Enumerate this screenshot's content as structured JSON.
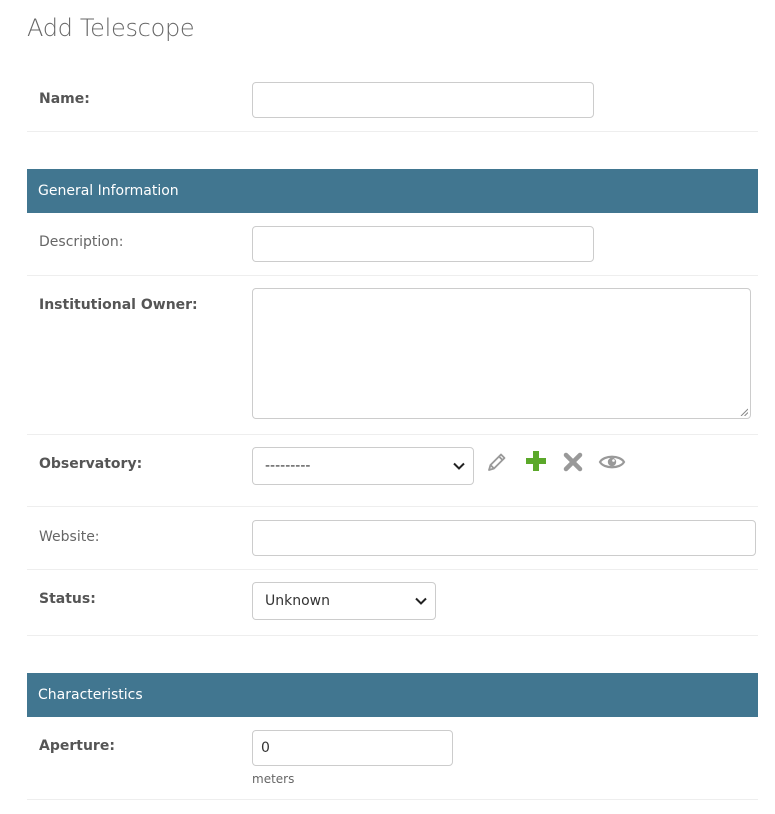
{
  "page": {
    "title": "Add Telescope"
  },
  "fields": {
    "name": {
      "label": "Name:",
      "value": ""
    },
    "description": {
      "label": "Description:",
      "value": ""
    },
    "institutional_owner": {
      "label": "Institutional Owner:",
      "value": ""
    },
    "observatory": {
      "label": "Observatory:",
      "selected": "---------"
    },
    "website": {
      "label": "Website:",
      "value": ""
    },
    "status": {
      "label": "Status:",
      "selected": "Unknown"
    },
    "aperture": {
      "label": "Aperture:",
      "value": "0",
      "help": "meters"
    }
  },
  "sections": {
    "general": {
      "title": "General Information"
    },
    "characteristics": {
      "title": "Characteristics"
    }
  },
  "icons": {
    "change": "pencil-icon",
    "add": "plus-icon",
    "delete": "x-icon",
    "view": "eye-icon"
  },
  "colors": {
    "module_header": "#417690",
    "add_icon": "#5ba82a",
    "muted_icon": "#999999"
  }
}
